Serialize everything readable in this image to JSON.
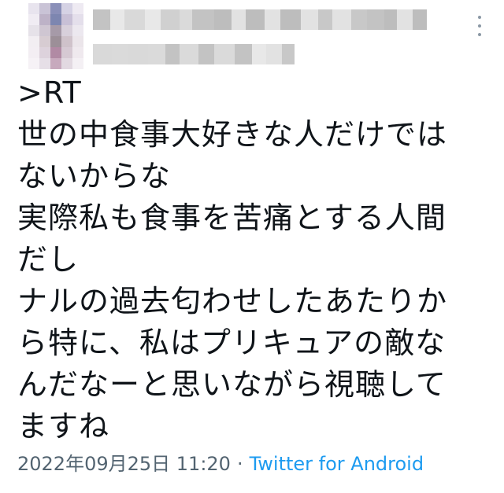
{
  "tweet": {
    "text_lines": [
      ">RT",
      "世の中食事大好きな人だけでは",
      "ないからな",
      "実際私も食事を苦痛とする人間",
      "だし",
      "ナルの過去匂わせしたあたりか",
      "ら特に、私はプリキュアの敵な",
      "んだなーと思いながら視聴して",
      "ますね"
    ],
    "timestamp": "2022年09月25日 11:20",
    "separator": "·",
    "source": "Twitter for Android"
  },
  "icons": {
    "more": "more-vertical-icon"
  },
  "colors": {
    "text": "#0f1419",
    "meta": "#536471",
    "link": "#1d9bf0"
  }
}
